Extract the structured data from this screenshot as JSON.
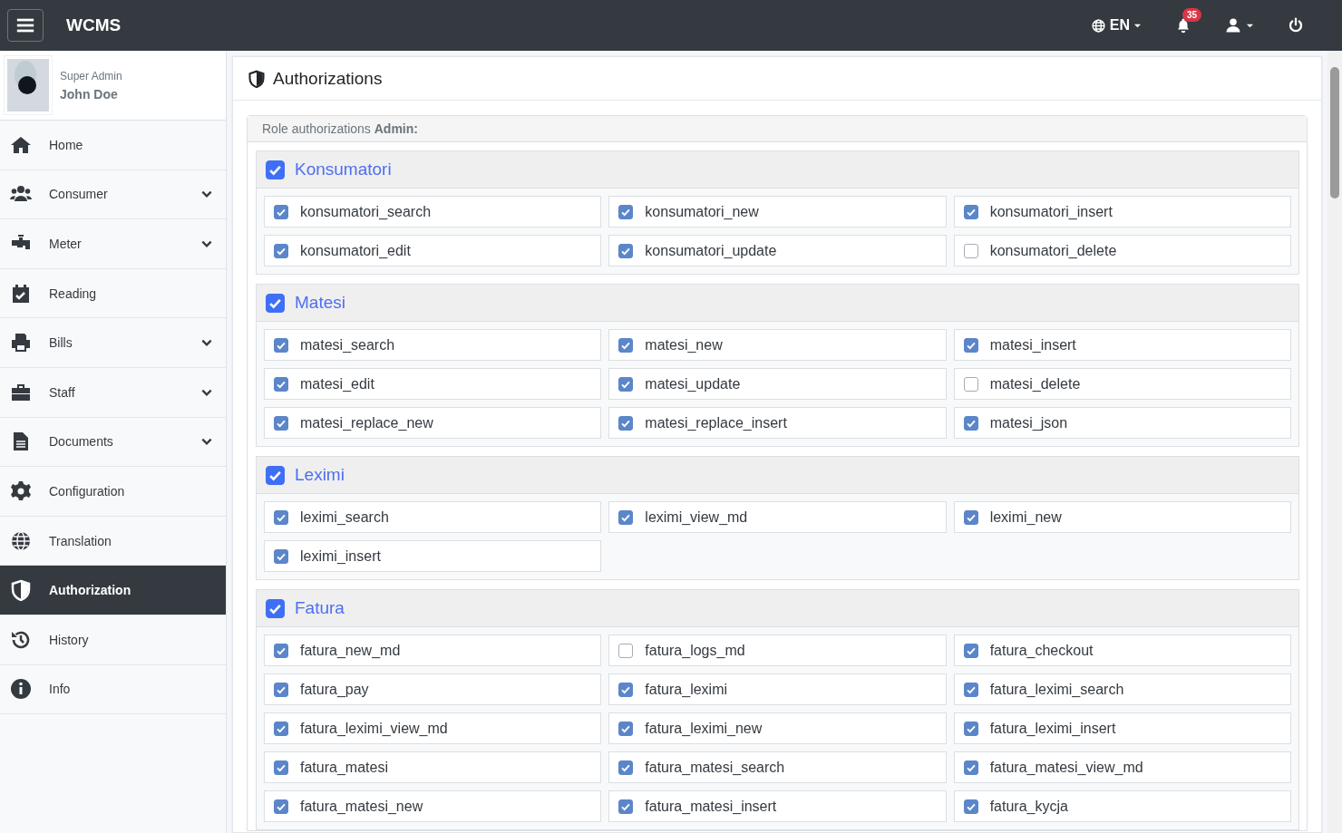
{
  "topbar": {
    "brand": "WCMS",
    "language": "EN",
    "notifications": "35"
  },
  "user": {
    "role": "Super Admin",
    "name": "John Doe"
  },
  "sidebar": {
    "items": [
      {
        "label": "Home",
        "expandable": false,
        "selected": false
      },
      {
        "label": "Consumer",
        "expandable": true,
        "selected": false
      },
      {
        "label": "Meter",
        "expandable": true,
        "selected": false
      },
      {
        "label": "Reading",
        "expandable": false,
        "selected": false
      },
      {
        "label": "Bills",
        "expandable": true,
        "selected": false
      },
      {
        "label": "Staff",
        "expandable": true,
        "selected": false
      },
      {
        "label": "Documents",
        "expandable": true,
        "selected": false
      },
      {
        "label": "Configuration",
        "expandable": false,
        "selected": false
      },
      {
        "label": "Translation",
        "expandable": false,
        "selected": false
      },
      {
        "label": "Authorization",
        "expandable": false,
        "selected": true
      },
      {
        "label": "History",
        "expandable": false,
        "selected": false
      },
      {
        "label": "Info",
        "expandable": false,
        "selected": false
      }
    ]
  },
  "page": {
    "title": "Authorizations",
    "role_line": "Role authorizations **Admin:**",
    "groups": [
      {
        "name": "Konsumatori",
        "checked": true,
        "permissions": [
          {
            "label": "konsumatori_search",
            "checked": true
          },
          {
            "label": "konsumatori_new",
            "checked": true
          },
          {
            "label": "konsumatori_insert",
            "checked": true
          },
          {
            "label": "konsumatori_edit",
            "checked": true
          },
          {
            "label": "konsumatori_update",
            "checked": true
          },
          {
            "label": "konsumatori_delete",
            "checked": false
          }
        ]
      },
      {
        "name": "Matesi",
        "checked": true,
        "permissions": [
          {
            "label": "matesi_search",
            "checked": true
          },
          {
            "label": "matesi_new",
            "checked": true
          },
          {
            "label": "matesi_insert",
            "checked": true
          },
          {
            "label": "matesi_edit",
            "checked": true
          },
          {
            "label": "matesi_update",
            "checked": true
          },
          {
            "label": "matesi_delete",
            "checked": false
          },
          {
            "label": "matesi_replace_new",
            "checked": true
          },
          {
            "label": "matesi_replace_insert",
            "checked": true
          },
          {
            "label": "matesi_json",
            "checked": true
          }
        ]
      },
      {
        "name": "Leximi",
        "checked": true,
        "permissions": [
          {
            "label": "leximi_search",
            "checked": true
          },
          {
            "label": "leximi_view_md",
            "checked": true
          },
          {
            "label": "leximi_new",
            "checked": true
          },
          {
            "label": "leximi_insert",
            "checked": true
          }
        ]
      },
      {
        "name": "Fatura",
        "checked": true,
        "permissions": [
          {
            "label": "fatura_new_md",
            "checked": true
          },
          {
            "label": "fatura_logs_md",
            "checked": false
          },
          {
            "label": "fatura_checkout",
            "checked": true
          },
          {
            "label": "fatura_pay",
            "checked": true
          },
          {
            "label": "fatura_leximi",
            "checked": true
          },
          {
            "label": "fatura_leximi_search",
            "checked": true
          },
          {
            "label": "fatura_leximi_view_md",
            "checked": true
          },
          {
            "label": "fatura_leximi_new",
            "checked": true
          },
          {
            "label": "fatura_leximi_insert",
            "checked": true
          },
          {
            "label": "fatura_matesi",
            "checked": true
          },
          {
            "label": "fatura_matesi_search",
            "checked": true
          },
          {
            "label": "fatura_matesi_view_md",
            "checked": true
          },
          {
            "label": "fatura_matesi_new",
            "checked": true
          },
          {
            "label": "fatura_matesi_insert",
            "checked": true
          },
          {
            "label": "fatura_kycja",
            "checked": true
          }
        ]
      }
    ]
  }
}
